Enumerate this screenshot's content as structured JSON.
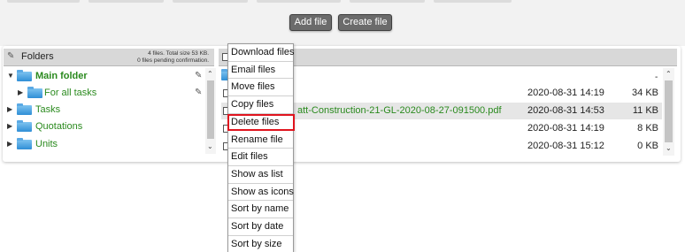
{
  "toolbar": {
    "add_file_label": "Add file",
    "create_file_label": "Create file"
  },
  "folders_panel": {
    "title": "Folders",
    "info_line1": "4 files. Total size 53 KB.",
    "info_line2": "0 files pending confirmation.",
    "tree": [
      {
        "label": "Main folder",
        "expanded": true,
        "bold": true
      },
      {
        "label": "For all tasks",
        "expanded": false,
        "bold": false
      },
      {
        "label": "Tasks",
        "expanded": false,
        "bold": false
      },
      {
        "label": "Quotations",
        "expanded": false,
        "bold": false
      },
      {
        "label": "Units",
        "expanded": false,
        "bold": false
      }
    ]
  },
  "files": [
    {
      "name": "",
      "date": "",
      "size": "-"
    },
    {
      "name": "",
      "date": "2020-08-31 14:19",
      "size": "34 KB"
    },
    {
      "name": "att-Construction-21-GL-2020-08-27-091500.pdf",
      "date": "2020-08-31 14:53",
      "size": "11 KB"
    },
    {
      "name": "",
      "date": "2020-08-31 14:19",
      "size": "8 KB"
    },
    {
      "name": "",
      "date": "2020-08-31 15:12",
      "size": "0 KB"
    }
  ],
  "context_menu": {
    "items": [
      "Download files",
      "Email files",
      "Move files",
      "Copy files",
      "Delete files",
      "Rename file",
      "Edit files",
      "Show as list",
      "Show as icons",
      "Sort by name",
      "Sort by date",
      "Sort by size"
    ],
    "highlighted": "Delete files"
  },
  "colors": {
    "folder_text": "#2a8a1e",
    "button_bg": "#6b6b6b",
    "highlight_border": "#e0141e",
    "header_bg": "#d8d8d8"
  }
}
